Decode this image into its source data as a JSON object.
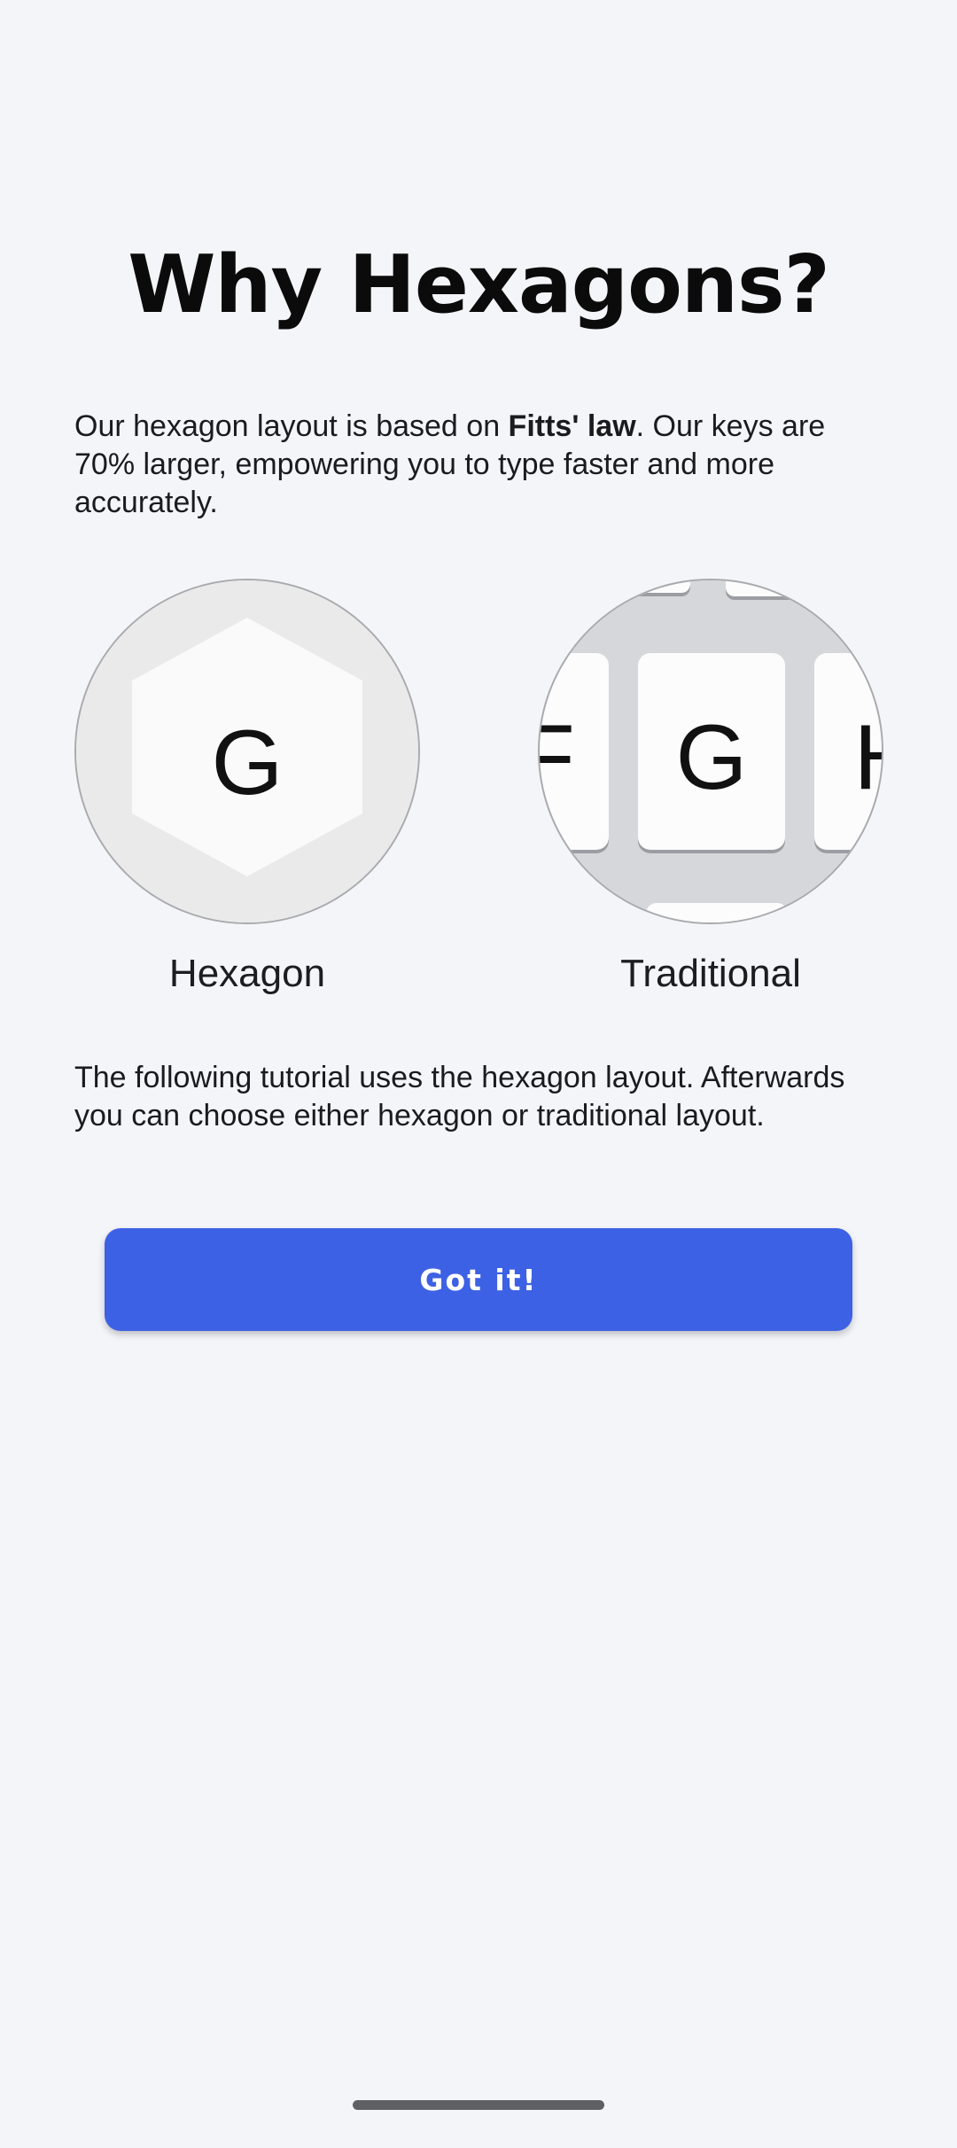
{
  "header": {
    "title": "Why Hexagons?"
  },
  "intro": {
    "before": "Our hexagon layout is based on ",
    "emphasis": "Fitts' law",
    "after": ". Our keys are 70% larger, empowering you to type faster and more accurately."
  },
  "comparison": {
    "hexagon": {
      "key_letter": "G",
      "label": "Hexagon"
    },
    "traditional": {
      "key_letter": "G",
      "left_neighbor": "F",
      "right_neighbor": "H",
      "label": "Traditional"
    }
  },
  "tutorial": {
    "text": "The following tutorial uses the hexagon layout. Afterwards you can choose either hexagon or traditional layout."
  },
  "actions": {
    "got_it_label": "Got it!"
  },
  "colors": {
    "background": "#f4f5f9",
    "accent": "#3d61e4"
  }
}
